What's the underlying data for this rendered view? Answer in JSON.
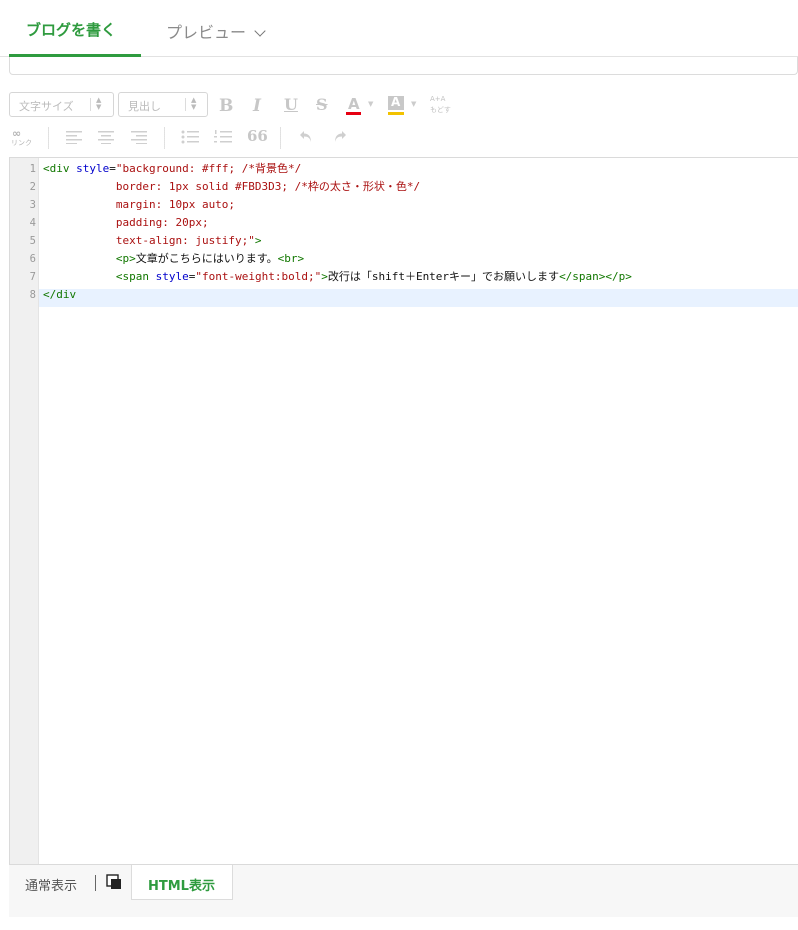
{
  "tabs": {
    "write_label": "ブログを書く",
    "preview_label": "プレビュー"
  },
  "toolbar": {
    "font_size_label": "文字サイズ",
    "heading_label": "見出し",
    "bold": "B",
    "italic": "I",
    "underline": "U",
    "strike": "S",
    "font_color": "A",
    "bg_color": "A",
    "link_label": "リンク",
    "reset_label_top": "A+A",
    "reset_label_bottom": "もどす",
    "quote": "66",
    "colors": {
      "font_color": "#e60012",
      "bg_color": "#f2c200",
      "accent": "#2f9b3f"
    }
  },
  "editor": {
    "line_numbers": [
      "1",
      "2",
      "3",
      "4",
      "5",
      "6",
      "7",
      "8"
    ],
    "lines": [
      [
        [
          "tag",
          "<div "
        ],
        [
          "attr",
          "style"
        ],
        [
          "text",
          "="
        ],
        [
          "str",
          "\"background: #fff; /*背景色*/"
        ]
      ],
      [
        [
          "str",
          "           border: 1px solid #FBD3D3; /*枠の太さ・形状・色*/"
        ]
      ],
      [
        [
          "str",
          "           margin: 10px auto;"
        ]
      ],
      [
        [
          "str",
          "           padding: 20px;"
        ]
      ],
      [
        [
          "str",
          "           text-align: justify;\""
        ],
        [
          "tag",
          ">"
        ]
      ],
      [
        [
          "text",
          "           "
        ],
        [
          "tag",
          "<p>"
        ],
        [
          "text",
          "文章がこちらにはいります。"
        ],
        [
          "tag",
          "<br>"
        ]
      ],
      [
        [
          "text",
          "           "
        ],
        [
          "tag",
          "<span "
        ],
        [
          "attr",
          "style"
        ],
        [
          "text",
          "="
        ],
        [
          "str",
          "\"font-weight:bold;\""
        ],
        [
          "tag",
          ">"
        ],
        [
          "text",
          "改行は「shift＋Enterキー」でお願いします"
        ],
        [
          "tag",
          "</span></p>"
        ]
      ],
      [
        [
          "tag",
          "</div"
        ]
      ]
    ]
  },
  "bottom_tabs": {
    "normal_label": "通常表示",
    "html_label": "HTML表示"
  }
}
